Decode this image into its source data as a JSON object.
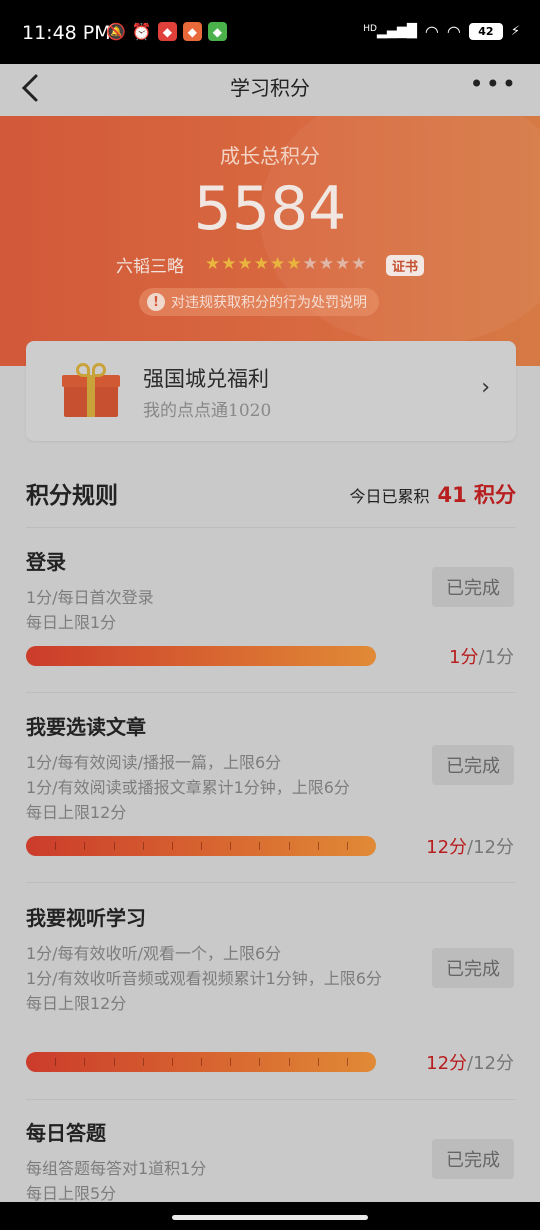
{
  "status_bar": {
    "time": "11:48 PM",
    "network": "HD",
    "battery": "42"
  },
  "nav": {
    "title": "学习积分",
    "more": "•••"
  },
  "hero": {
    "label": "成长总积分",
    "score": "5584",
    "rank": "六韬三略",
    "stars_filled": 6,
    "stars_total": 10,
    "cert_label": "证书",
    "penalty_text": "对违规获取积分的行为处罚说明"
  },
  "benefits": {
    "title": "强国城兑福利",
    "subtitle": "我的点点通1020"
  },
  "rules": {
    "title": "积分规则",
    "today_label": "今日已累积",
    "today_points": "41 积分",
    "items": [
      {
        "title": "登录",
        "desc": [
          "1分/每日首次登录",
          "每日上限1分"
        ],
        "status": "已完成",
        "earned": "1分",
        "limit": "/1分",
        "progress": 1.0,
        "segments": 1
      },
      {
        "title": "我要选读文章",
        "desc": [
          "1分/每有效阅读/播报一篇，上限6分",
          "1分/有效阅读或播报文章累计1分钟，上限6分",
          "每日上限12分"
        ],
        "status": "已完成",
        "earned": "12分",
        "limit": "/12分",
        "progress": 1.0,
        "segments": 12
      },
      {
        "title": "我要视听学习",
        "desc": [
          "1分/每有效收听/观看一个，上限6分",
          "1分/有效收听音频或观看视频累计1分钟，上限6分",
          "每日上限12分"
        ],
        "status": "已完成",
        "earned": "12分",
        "limit": "/12分",
        "progress": 1.0,
        "segments": 12
      },
      {
        "title": "每日答题",
        "desc": [
          "每组答题每答对1道积1分",
          "每日上限5分"
        ],
        "status": "已完成"
      }
    ]
  }
}
